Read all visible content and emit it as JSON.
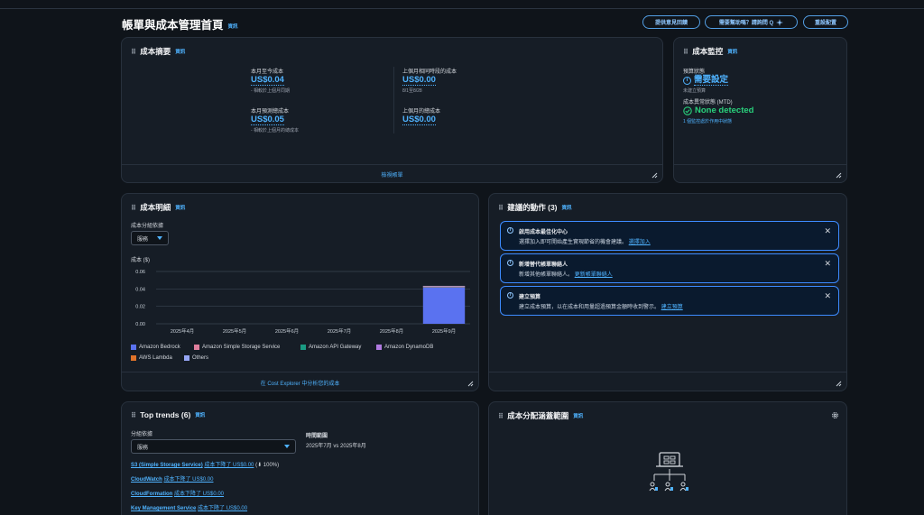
{
  "header": {
    "title": "帳單與成本管理首頁",
    "info": "資訊",
    "feedback_label": "提供意見回饋",
    "help_label": "需要幫助嗎？請詢問 Q",
    "reset_label": "重設配置"
  },
  "cost_summary": {
    "title": "成本摘要",
    "info": "資訊",
    "mtd_label": "本月至今成本",
    "mtd_value": "US$0.04",
    "mtd_note": "- 相較於上個月同期",
    "forecast_label": "本月預測總成本",
    "forecast_value": "US$0.05",
    "forecast_note": "- 相較於上個月的總成本",
    "lastmonth_period_label": "上個月相同時段的成本",
    "lastmonth_period_value": "US$0.00",
    "lastmonth_period_note": "8/1至8/28",
    "lastmonth_total_label": "上個月的總成本",
    "lastmonth_total_value": "US$0.00",
    "footer_link": "檢視帳單"
  },
  "cost_monitor": {
    "title": "成本監控",
    "info": "資訊",
    "budget_label": "預算狀態",
    "budget_value": "需要設定",
    "budget_note": "未建立預算",
    "anomaly_label": "成本異常狀態 (MTD)",
    "anomaly_value": "None detected",
    "anomaly_note": "1 個監控處於作用中狀態"
  },
  "cost_breakdown": {
    "title": "成本明細",
    "info": "資訊",
    "group_label": "成本分組依據",
    "group_value": "服務",
    "chart_label": "成本 ($)",
    "footer_link": "在 Cost Explorer 中分析您的成本"
  },
  "chart_data": {
    "type": "bar",
    "categories": [
      "2025年4月",
      "2025年5月",
      "2025年6月",
      "2025年7月",
      "2025年8月",
      "2025年9月"
    ],
    "ylim": [
      0,
      0.06
    ],
    "yticks": [
      "0.00",
      "0.02",
      "0.04",
      "0.06"
    ],
    "series": [
      {
        "name": "Amazon Bedrock",
        "color": "#5a72f0",
        "values": [
          0,
          0,
          0,
          0,
          0,
          0.0415
        ]
      },
      {
        "name": "Amazon Simple Storage Service",
        "color": "#e07f9d",
        "values": [
          0,
          0,
          0,
          0,
          0,
          0.0008
        ]
      },
      {
        "name": "Amazon API Gateway",
        "color": "#1a9a82",
        "values": [
          0,
          0,
          0,
          0,
          0,
          0.0003
        ]
      },
      {
        "name": "Amazon DynamoDB",
        "color": "#b07ae0",
        "values": [
          0,
          0,
          0,
          0,
          0,
          0.0003
        ]
      },
      {
        "name": "AWS Lambda",
        "color": "#e0732a",
        "values": [
          0,
          0,
          0,
          0,
          0,
          0.0003
        ]
      },
      {
        "name": "Others",
        "color": "#96a6f5",
        "values": [
          0,
          0,
          0,
          0,
          0,
          0.0003
        ]
      }
    ],
    "grid": true,
    "legend": "bottom"
  },
  "recommended": {
    "title": "建議的動作 (3)",
    "info": "資訊",
    "items": [
      {
        "title": "啟用成本最佳化中心",
        "desc": "選擇加入即可開始產生實現節省的機會建議。",
        "link": "選擇加入"
      },
      {
        "title": "新增替代帳單聯絡人",
        "desc": "新增其他帳單聯絡人。",
        "link": "更新帳單聯絡人"
      },
      {
        "title": "建立預算",
        "desc": "建立成本預算，以在成本和用量超過預算金額時收到警示。",
        "link": "建立預算"
      }
    ]
  },
  "top_trends": {
    "title": "Top trends (6)",
    "info": "資訊",
    "group_label": "分組依據",
    "group_value": "服務",
    "range_label": "時間範圍",
    "range_value": "2025年7月 vs 2025年8月",
    "items": [
      {
        "service": "S3 (Simple Storage Service)",
        "change": "成本下降了 US$0.00",
        "pct": "(⬇ 100%)"
      },
      {
        "service": "CloudWatch",
        "change": "成本下降了 US$0.00",
        "pct": ""
      },
      {
        "service": "CloudFormation",
        "change": "成本下降了 US$0.00",
        "pct": ""
      },
      {
        "service": "Key Management Service",
        "change": "成本下降了 US$0.00",
        "pct": ""
      }
    ]
  },
  "allocation": {
    "title": "成本分配涵蓋範圍",
    "info": "資訊"
  },
  "colors": {
    "accent": "#4fb3ff",
    "success": "#29d17c",
    "panel": "#161d26",
    "background": "#0f141a"
  }
}
